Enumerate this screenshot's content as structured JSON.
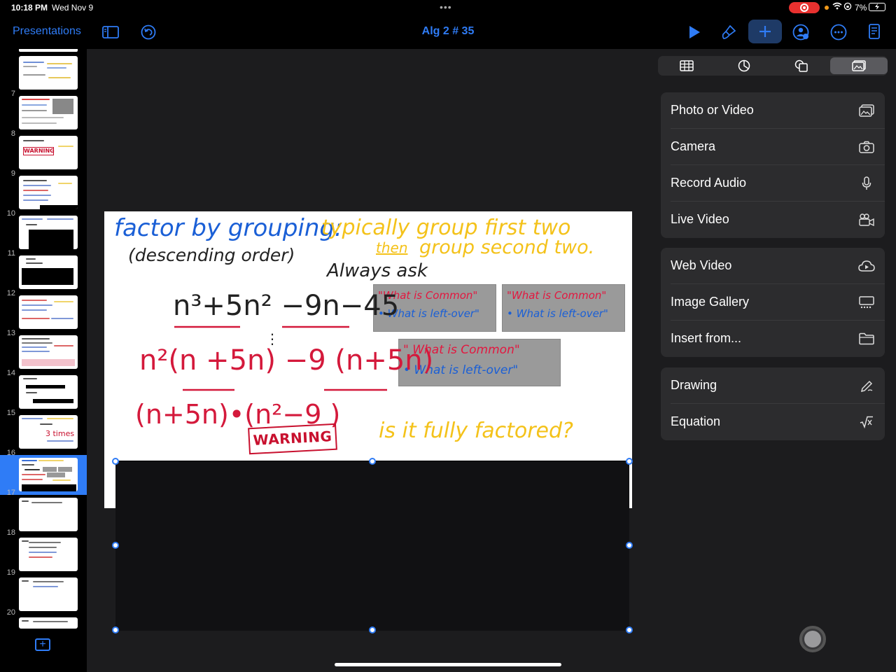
{
  "status": {
    "time": "10:18 PM",
    "date": "Wed Nov 9",
    "battery": "7%"
  },
  "toolbar": {
    "presentations_label": "Presentations",
    "title": "Alg 2 # 35",
    "accent": "#2f7cf6"
  },
  "sidebar": {
    "slide_numbers": [
      "7",
      "8",
      "9",
      "10",
      "11",
      "12",
      "13",
      "14",
      "15",
      "16",
      "17",
      "18",
      "19",
      "20"
    ],
    "selected_slide": "17",
    "thumb_text": {
      "warning": "WARNING",
      "three_times": "3 times"
    }
  },
  "slide": {
    "heading": "factor by grouping:",
    "subheading": "(descending order)",
    "note_line1": "typically group first two",
    "note_then": "then",
    "note_line2": "group second two.",
    "always_ask": "Always ask",
    "expr1": "n³+5n² −9n−45",
    "expr2": "n²(n +5n) −9 (n+5n)",
    "expr3": "(n+5n)•(n²−9 )",
    "warning": "WARNING",
    "fully_factored": "is it fully factored?",
    "box1": {
      "q1": "\"What is Common\"",
      "q2": "• What is left-over\""
    },
    "box2": {
      "q1": "\"What is Common\"",
      "q2": "• What is left-over\""
    },
    "box3": {
      "q1": "\" What is Common\"",
      "q2": "• What is left-over\""
    }
  },
  "panel": {
    "tabs": [
      "table-icon",
      "chart-icon",
      "shape-icon",
      "media-icon"
    ],
    "group1": [
      "Photo or Video",
      "Camera",
      "Record Audio",
      "Live Video"
    ],
    "group2": [
      "Web Video",
      "Image Gallery",
      "Insert from..."
    ],
    "group3": [
      "Drawing",
      "Equation"
    ]
  }
}
